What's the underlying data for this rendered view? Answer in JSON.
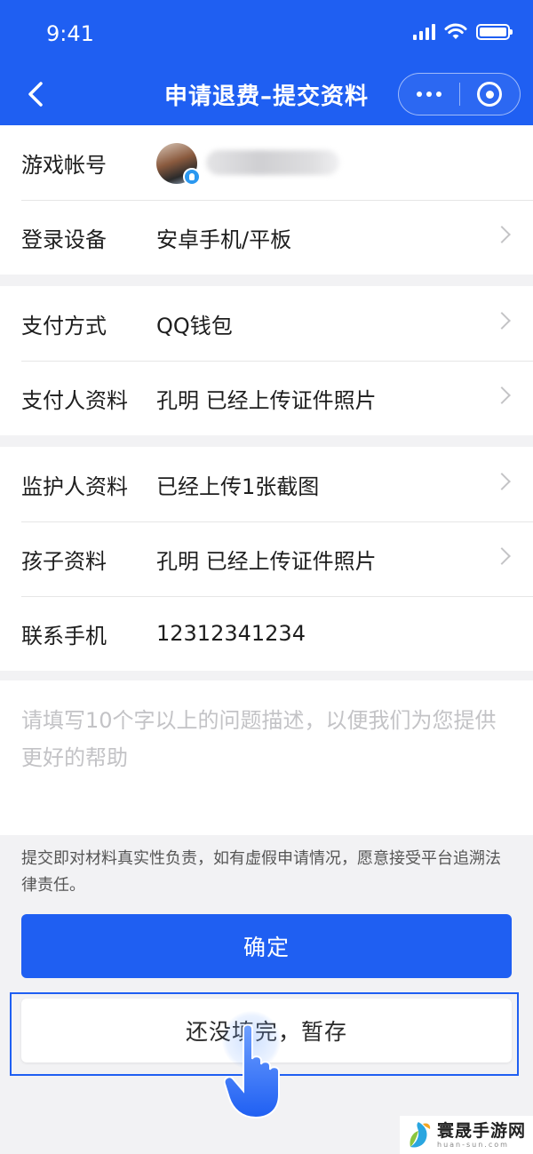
{
  "status_bar": {
    "time": "9:41"
  },
  "nav": {
    "title": "申请退费–提交资料",
    "back_icon": "chevron-left-icon",
    "more_icon": "more-dots-icon",
    "close_icon": "target-close-icon"
  },
  "sections": [
    {
      "rows": [
        {
          "label": "游戏帐号",
          "value": "",
          "has_avatar": true,
          "arrow": false
        },
        {
          "label": "登录设备",
          "value": "安卓手机/平板",
          "arrow": true
        }
      ]
    },
    {
      "rows": [
        {
          "label": "支付方式",
          "value": "QQ钱包",
          "arrow": true
        },
        {
          "label": "支付人资料",
          "value": "孔明 已经上传证件照片",
          "arrow": true
        }
      ]
    },
    {
      "rows": [
        {
          "label": "监护人资料",
          "value": "已经上传1张截图",
          "arrow": true
        },
        {
          "label": "孩子资料",
          "value": "孔明 已经上传证件照片",
          "arrow": true
        },
        {
          "label": "联系手机",
          "value": "12312341234",
          "arrow": false
        }
      ]
    }
  ],
  "description": {
    "placeholder": "请填写10个字以上的问题描述，以便我们为您提供更好的帮助"
  },
  "disclaimer": "提交即对材料真实性负责，如有虚假申请情况，愿意接受平台追溯法律责任。",
  "buttons": {
    "confirm": "确定",
    "save_draft": "还没填完，暂存"
  },
  "watermark": {
    "name": "寰晟手游网",
    "url": "huan-sun.com"
  },
  "colors": {
    "primary": "#1f5ff2",
    "background": "#f2f2f4",
    "placeholder": "#c3c3c6"
  }
}
